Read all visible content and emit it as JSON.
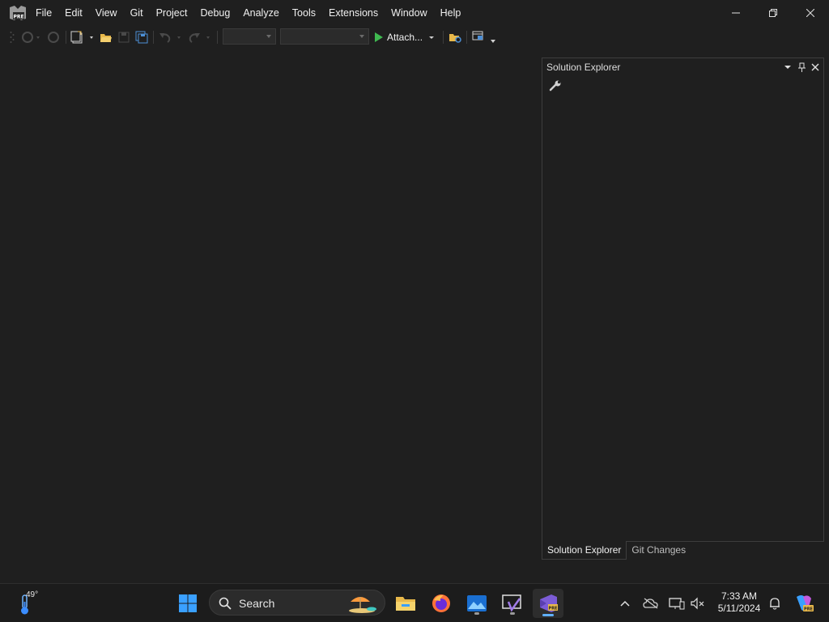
{
  "window": {
    "logo_badge": "PRE",
    "menu": [
      "File",
      "Edit",
      "View",
      "Git",
      "Project",
      "Debug",
      "Analyze",
      "Tools",
      "Extensions",
      "Window",
      "Help"
    ]
  },
  "toolbar": {
    "attach_label": "Attach...",
    "config_combo_value": "",
    "platform_combo_value": ""
  },
  "solution_explorer": {
    "title": "Solution Explorer",
    "tabs": [
      "Solution Explorer",
      "Git Changes"
    ]
  },
  "taskbar": {
    "weather_temp": "49°",
    "search_label": "Search",
    "time": "7:33 AM",
    "date": "5/11/2024"
  },
  "colors": {
    "background": "#1f1f1f",
    "accent": "#7c5cd6",
    "play_green": "#3fb950",
    "folder_yellow": "#e8b84a",
    "windows_blue": "#1e90ff"
  }
}
